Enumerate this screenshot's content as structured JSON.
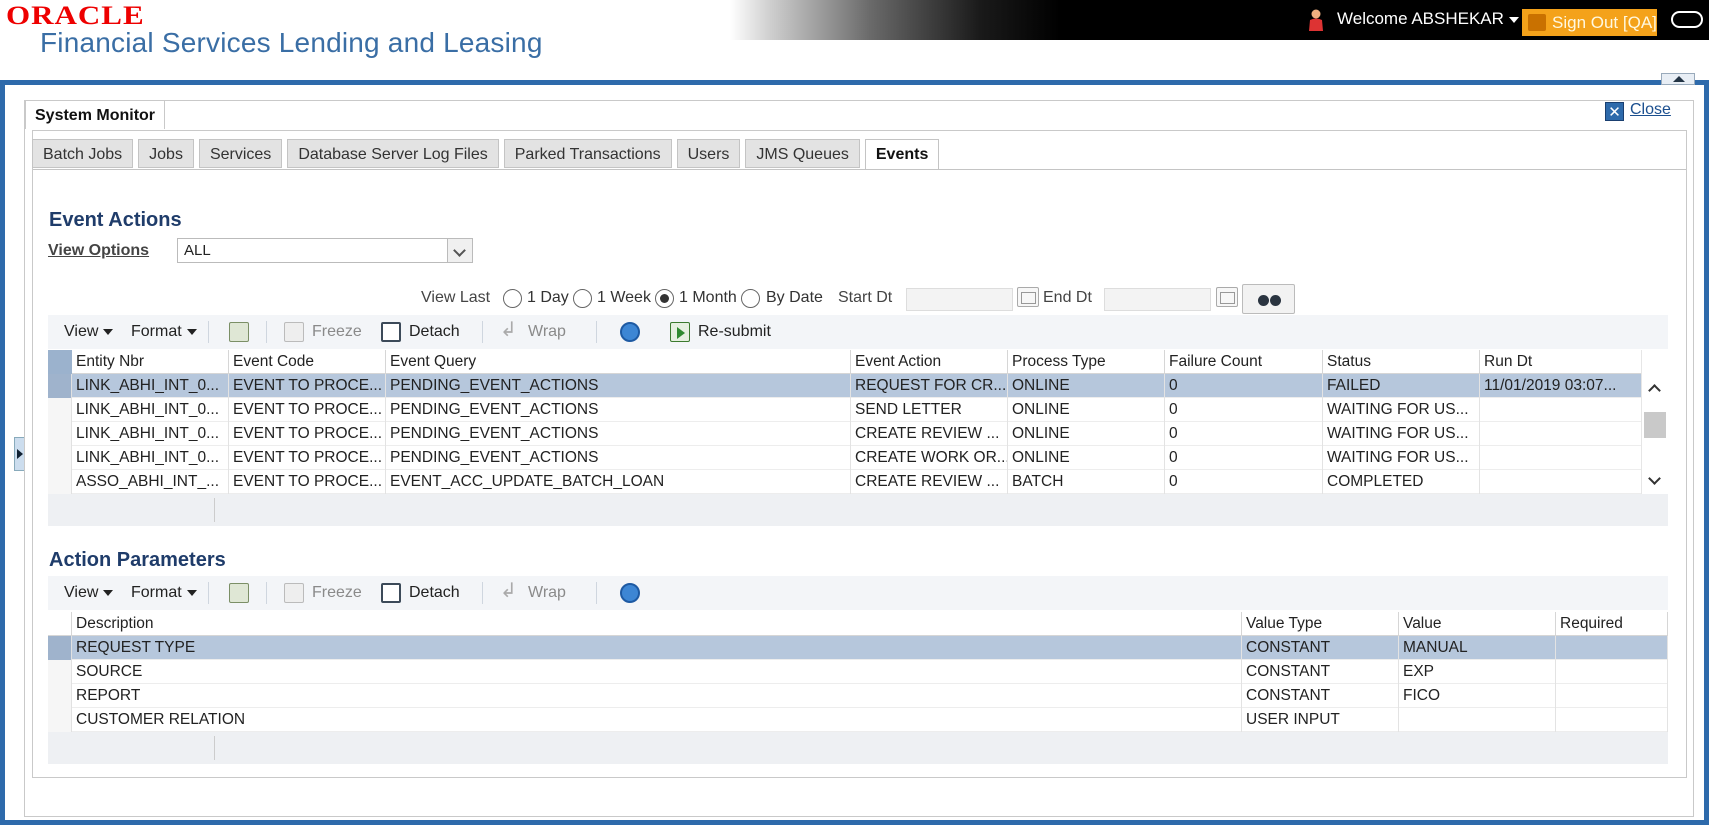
{
  "header": {
    "brand": "ORACLE",
    "product": "Financial Services Lending and Leasing",
    "welcome": "Welcome ABSHEKAR",
    "signout": "Sign Out [QA]"
  },
  "window": {
    "title": "System Monitor",
    "close_label": "Close"
  },
  "tabs": [
    {
      "label": "Batch Jobs"
    },
    {
      "label": "Jobs"
    },
    {
      "label": "Services"
    },
    {
      "label": "Database Server Log Files"
    },
    {
      "label": "Parked Transactions"
    },
    {
      "label": "Users"
    },
    {
      "label": "JMS Queues"
    },
    {
      "label": "Events",
      "active": true
    }
  ],
  "event_actions": {
    "title": "Event Actions",
    "view_options_label": "View Options",
    "view_options_value": "ALL",
    "view_last_label": "View Last",
    "radios": [
      "1 Day",
      "1 Week",
      "1 Month",
      "By Date"
    ],
    "selected_radio": "1 Month",
    "start_dt_label": "Start Dt",
    "end_dt_label": "End Dt",
    "toolbar": {
      "view": "View",
      "format": "Format",
      "freeze": "Freeze",
      "detach": "Detach",
      "wrap": "Wrap",
      "resubmit": "Re-submit"
    },
    "columns": [
      "Entity Nbr",
      "Event Code",
      "Event Query",
      "Event Action",
      "Process Type",
      "Failure Count",
      "Status",
      "Run Dt"
    ],
    "rows": [
      [
        "LINK_ABHI_INT_0...",
        "EVENT TO PROCE...",
        "PENDING_EVENT_ACTIONS",
        "REQUEST FOR CR...",
        "ONLINE",
        "0",
        "FAILED",
        "11/01/2019 03:07..."
      ],
      [
        "LINK_ABHI_INT_0...",
        "EVENT TO PROCE...",
        "PENDING_EVENT_ACTIONS",
        "SEND LETTER",
        "ONLINE",
        "0",
        "WAITING FOR US...",
        ""
      ],
      [
        "LINK_ABHI_INT_0...",
        "EVENT TO PROCE...",
        "PENDING_EVENT_ACTIONS",
        "CREATE REVIEW ...",
        "ONLINE",
        "0",
        "WAITING FOR US...",
        ""
      ],
      [
        "LINK_ABHI_INT_0...",
        "EVENT TO PROCE...",
        "PENDING_EVENT_ACTIONS",
        "CREATE WORK OR...",
        "ONLINE",
        "0",
        "WAITING FOR US...",
        ""
      ],
      [
        "ASSO_ABHI_INT_...",
        "EVENT TO PROCE...",
        "EVENT_ACC_UPDATE_BATCH_LOAN",
        "CREATE REVIEW ...",
        "BATCH",
        "0",
        "COMPLETED",
        ""
      ]
    ]
  },
  "action_parameters": {
    "title": "Action Parameters",
    "toolbar": {
      "view": "View",
      "format": "Format",
      "freeze": "Freeze",
      "detach": "Detach",
      "wrap": "Wrap"
    },
    "columns": [
      "Description",
      "Value Type",
      "Value",
      "Required"
    ],
    "rows": [
      [
        "REQUEST TYPE",
        "CONSTANT",
        "MANUAL",
        ""
      ],
      [
        "SOURCE",
        "CONSTANT",
        "EXP",
        ""
      ],
      [
        "REPORT",
        "CONSTANT",
        "FICO",
        ""
      ],
      [
        "CUSTOMER RELATION",
        "USER INPUT",
        "",
        ""
      ]
    ]
  }
}
